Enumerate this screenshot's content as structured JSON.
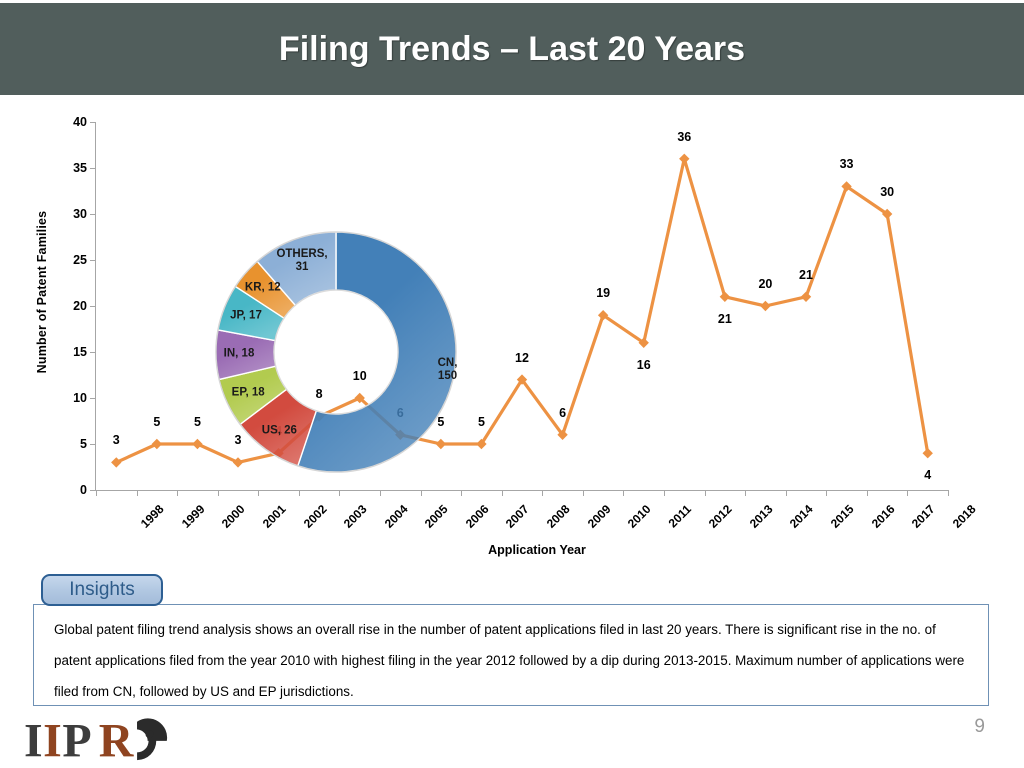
{
  "slide": {
    "title": "Filing Trends – Last 20 Years",
    "page_number": "9",
    "logo_text": "IIPRD",
    "title_bar_color": "#515e5c"
  },
  "chart_data": [
    {
      "type": "line",
      "title": "",
      "xlabel": "Application Year",
      "ylabel": "Number of Patent Families",
      "ylim": [
        0,
        40
      ],
      "ytick_step": 5,
      "yticks": [
        "0",
        "5",
        "10",
        "15",
        "20",
        "25",
        "30",
        "35",
        "40"
      ],
      "grid": false,
      "legend": "none",
      "series_color": "#ed9243",
      "marker": "diamond",
      "data_labels": true,
      "categories": [
        "1998",
        "1999",
        "2000",
        "2001",
        "2002",
        "2003",
        "2004",
        "2005",
        "2006",
        "2007",
        "2008",
        "2009",
        "2010",
        "2011",
        "2012",
        "2013",
        "2014",
        "2015",
        "2016",
        "2017",
        "2018"
      ],
      "values": [
        3,
        5,
        5,
        3,
        4,
        8,
        10,
        6,
        5,
        5,
        12,
        6,
        19,
        16,
        36,
        21,
        20,
        21,
        33,
        30,
        4
      ],
      "label_below": [
        "2011",
        "2013",
        "2018"
      ]
    },
    {
      "type": "pie",
      "subtype": "doughnut",
      "title": "",
      "legend": "none",
      "data_labels": true,
      "labels": [
        "CN",
        "US",
        "EP",
        "IN",
        "JP",
        "KR",
        "OTHERS"
      ],
      "values": [
        150,
        26,
        18,
        18,
        17,
        12,
        31
      ],
      "display_labels": [
        "CN, 150",
        "US, 26",
        "EP, 18",
        "IN, 18",
        "JP, 17",
        "KR, 12",
        "OTHERS,\n31"
      ],
      "colors": [
        "#4380b8",
        "#d24b3f",
        "#b2cb4f",
        "#9a6cb4",
        "#48b7c6",
        "#e8922e",
        "#8cafd6"
      ]
    }
  ],
  "insights": {
    "tab_label": "Insights",
    "body": "Global patent filing trend analysis shows an overall rise in the number of patent applications filed in last 20 years. There is significant rise in the no. of patent applications filed from the year 2010 with highest filing in the year 2012 followed by a dip during 2013-2015. Maximum number of applications were filed from CN, followed by US  and EP jurisdictions.",
    "border_color": "#6f91b5",
    "tab_border_color": "#2d5f93",
    "tab_text_color": "#2e5c8a"
  }
}
